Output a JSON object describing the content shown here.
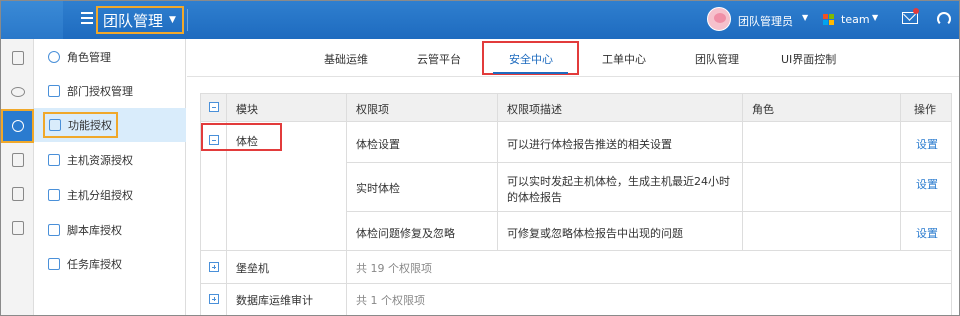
{
  "header": {
    "team_switch_label": "团队管理",
    "user_name": "团队管理员",
    "brand_name": "team",
    "colors": {
      "topbar": "#1e6bbf",
      "highlight_orange": "#f0a82a",
      "highlight_red": "#e23b3b",
      "link": "#2a7bcf"
    }
  },
  "sidebar": {
    "items": [
      {
        "label": "角色管理",
        "icon": "users-icon"
      },
      {
        "label": "部门授权管理",
        "icon": "org-chart-icon"
      },
      {
        "label": "功能授权",
        "icon": "list-icon",
        "active": true
      },
      {
        "label": "主机资源授权",
        "icon": "monitor-icon"
      },
      {
        "label": "主机分组授权",
        "icon": "folder-icon"
      },
      {
        "label": "脚本库授权",
        "icon": "script-icon"
      },
      {
        "label": "任务库授权",
        "icon": "clipboard-icon"
      }
    ]
  },
  "tabs": [
    {
      "label": "基础运维"
    },
    {
      "label": "云管平台"
    },
    {
      "label": "安全中心",
      "active": true
    },
    {
      "label": "工单中心"
    },
    {
      "label": "团队管理"
    },
    {
      "label": "UI界面控制"
    }
  ],
  "table": {
    "headers": {
      "module": "模块",
      "permission": "权限项",
      "description": "权限项描述",
      "role": "角色",
      "action": "操作"
    },
    "groups": [
      {
        "name": "体检",
        "expanded": true,
        "rows": [
          {
            "permission": "体检设置",
            "description": "可以进行体检报告推送的相关设置",
            "action": "设置"
          },
          {
            "permission": "实时体检",
            "description_line1": "可以实时发起主机体检，生成主机最近24小时",
            "description_line2": "的体检报告",
            "action": "设置"
          },
          {
            "permission": "体检问题修复及忽略",
            "description": "可修复或忽略体检报告中出现的问题",
            "action": "设置"
          }
        ]
      },
      {
        "name": "堡垒机",
        "expanded": false,
        "summary": "共 19 个权限项"
      },
      {
        "name": "数据库运维审计",
        "expanded": false,
        "summary": "共 1 个权限项"
      }
    ]
  }
}
